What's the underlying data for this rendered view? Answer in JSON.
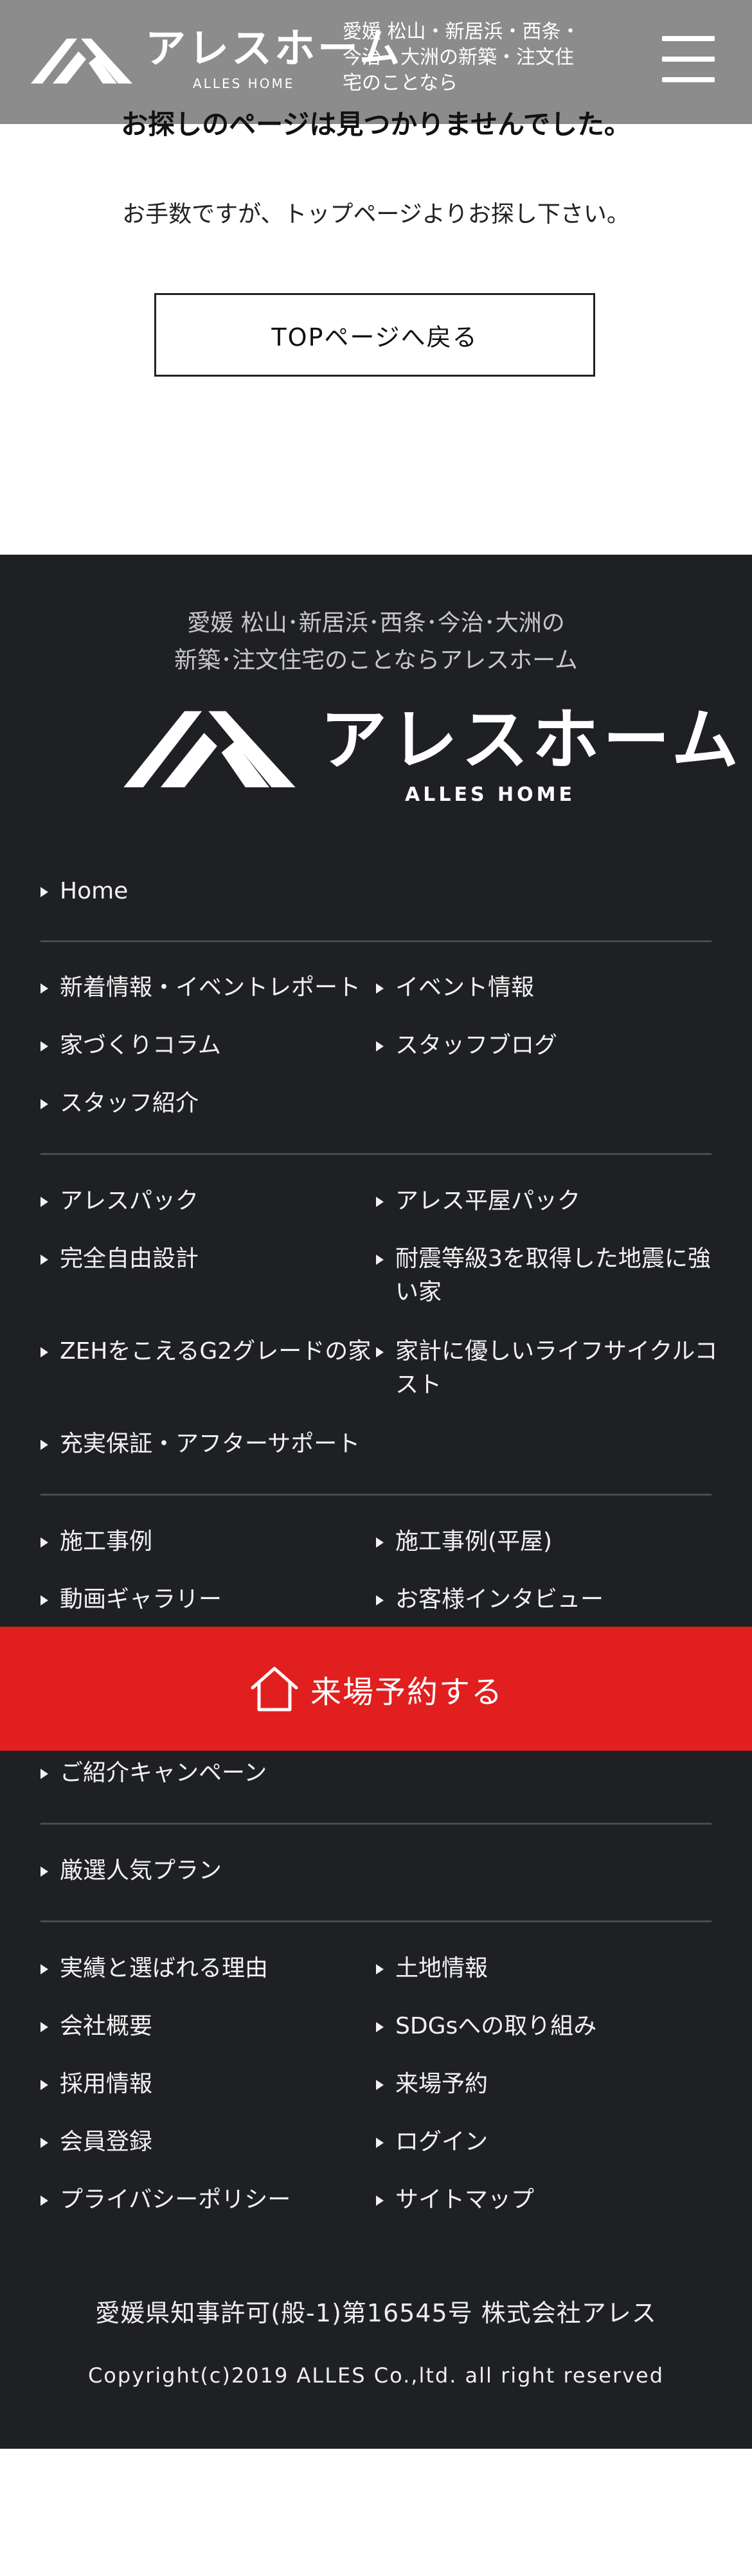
{
  "header": {
    "brand_name": "アレスホーム",
    "brand_en": "ALLES HOME",
    "tagline": "愛媛 松山・新居浜・西条・今治・大洲の新築・注文住宅のことなら",
    "logo_icon": "alles-logo-mark",
    "menu_icon": "hamburger-menu-icon"
  },
  "not_found": {
    "title": "お探しのページは見つかりませんでした。",
    "description": "お手数ですが、トップページよりお探し下さい。",
    "button": "TOPページへ戻る"
  },
  "footer": {
    "tagline_line1": "愛媛 松山･新居浜･西条･今治･大洲の",
    "tagline_line2": "新築･注文住宅のことならアレスホーム",
    "brand_name": "アレスホーム",
    "brand_en": "ALLES HOME",
    "nav": {
      "home": "Home",
      "news": "新着情報・イベントレポート",
      "events": "イベント情報",
      "column": "家づくりコラム",
      "staff_blog": "スタッフブログ",
      "staff": "スタッフ紹介",
      "alles_pack": "アレスパック",
      "hiraya_pack": "アレス平屋パック",
      "free_design": "完全自由設計",
      "earthquake_line1": "耐震等級3を取得した地震に強",
      "earthquake_line2": "い家",
      "zeh": "ZEHをこえるG2グレードの家",
      "lifecycle_line1": "家計に優しいライフサイクルコ",
      "lifecycle_line2": "スト",
      "warranty": "充実保証・アフターサポート",
      "cases": "施工事例",
      "cases_hiraya": "施工事例(平屋)",
      "video": "動画ギャラリー",
      "interview": "お客様インタビュー",
      "referral": "ご紹介キャンペーン",
      "popular_plan": "厳選人気プラン",
      "reasons": "実績と選ばれる理由",
      "land": "土地情報",
      "company": "会社概要",
      "sdgs": "SDGsへの取り組み",
      "recruit": "採用情報",
      "visit": "来場予約",
      "register": "会員登録",
      "login": "ログイン",
      "privacy": "プライバシーポリシー",
      "sitemap": "サイトマップ"
    },
    "license": "愛媛県知事許可(般-1)第16545号 株式会社アレス",
    "copyright": "Copyright(c)2019 ALLES Co.,ltd. all right reserved"
  },
  "reserve_bar": {
    "label": "来場予約する",
    "icon": "house-icon",
    "color": "#e11f1f"
  }
}
